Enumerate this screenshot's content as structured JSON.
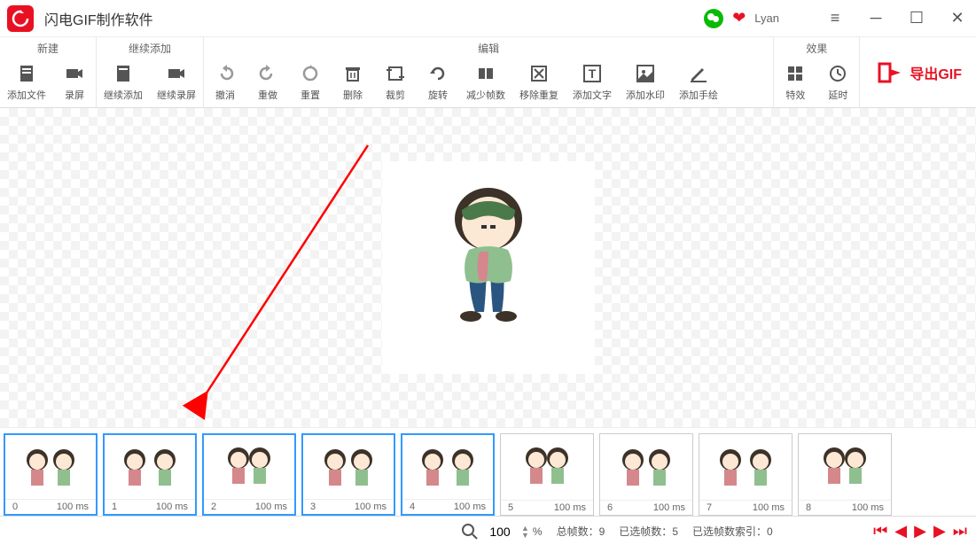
{
  "app": {
    "title": "闪电GIF制作软件",
    "user": "Lyan"
  },
  "groups": {
    "new": {
      "title": "新建",
      "addFile": "添加文件",
      "record": "录屏"
    },
    "append": {
      "title": "继续添加",
      "addMore": "继续添加",
      "recordMore": "继续录屏"
    },
    "edit": {
      "title": "编辑",
      "undo": "撤消",
      "redo": "重做",
      "reset": "重置",
      "delete": "删除",
      "crop": "裁剪",
      "rotate": "旋转",
      "reduceFrames": "减少帧数",
      "removeDup": "移除重复",
      "addText": "添加文字",
      "addWatermark": "添加水印",
      "addDraw": "添加手绘"
    },
    "effect": {
      "title": "效果",
      "special": "特效",
      "delay": "延时"
    },
    "export": "导出GIF"
  },
  "zoom": {
    "value": "100",
    "unit": "%"
  },
  "status": {
    "totalFramesLabel": "总帧数：",
    "totalFrames": "9",
    "selectedLabel": "已选帧数：",
    "selectedCount": "5",
    "selectedIndexLabel": "已选帧数索引：",
    "selectedIndex": "0"
  },
  "frames": [
    {
      "idx": "0",
      "ms": "100 ms",
      "selected": true
    },
    {
      "idx": "1",
      "ms": "100 ms",
      "selected": true
    },
    {
      "idx": "2",
      "ms": "100 ms",
      "selected": true
    },
    {
      "idx": "3",
      "ms": "100 ms",
      "selected": true
    },
    {
      "idx": "4",
      "ms": "100 ms",
      "selected": true
    },
    {
      "idx": "5",
      "ms": "100 ms",
      "selected": false
    },
    {
      "idx": "6",
      "ms": "100 ms",
      "selected": false
    },
    {
      "idx": "7",
      "ms": "100 ms",
      "selected": false
    },
    {
      "idx": "8",
      "ms": "100 ms",
      "selected": false
    }
  ]
}
